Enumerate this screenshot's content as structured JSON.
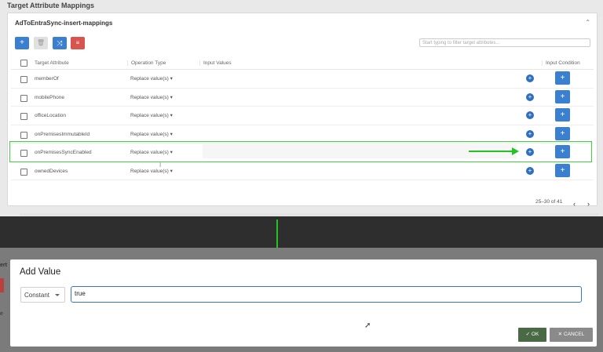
{
  "section_title": "Target Attribute Mappings",
  "card": {
    "title": "AdToEntraSync-insert-mappings",
    "filter_placeholder": "Start typing to filter target attributes...",
    "toolbar": {
      "add": "+",
      "delete": "🗑",
      "shuffle": "⤨",
      "clear": "≡"
    }
  },
  "table": {
    "headers": {
      "attribute": "Target Attribute",
      "operation": "Operation Type",
      "values": "Input Values",
      "condition": "Input Condition"
    },
    "rows": [
      {
        "attribute": "memberOf",
        "operation": "Replace value(s)"
      },
      {
        "attribute": "mobilePhone",
        "operation": "Replace value(s)"
      },
      {
        "attribute": "officeLocation",
        "operation": "Replace value(s)"
      },
      {
        "attribute": "onPremisesImmutableId",
        "operation": "Replace value(s)"
      },
      {
        "attribute": "onPremisesSyncEnabled",
        "operation": "Replace value(s)"
      },
      {
        "attribute": "ownedDevices",
        "operation": "Replace value(s)"
      }
    ],
    "pager": "25–30 of 41"
  },
  "modal": {
    "title": "Add Value",
    "type_select": "Constant",
    "value_input": "true",
    "ok_label": "OK",
    "cancel_label": "CANCEL"
  },
  "background": {
    "fragment": "ert",
    "e": "e"
  },
  "colors": {
    "primary": "#3a7fd0",
    "danger": "#d9534f",
    "highlight": "#22c322",
    "ok": "#4a6a45"
  }
}
